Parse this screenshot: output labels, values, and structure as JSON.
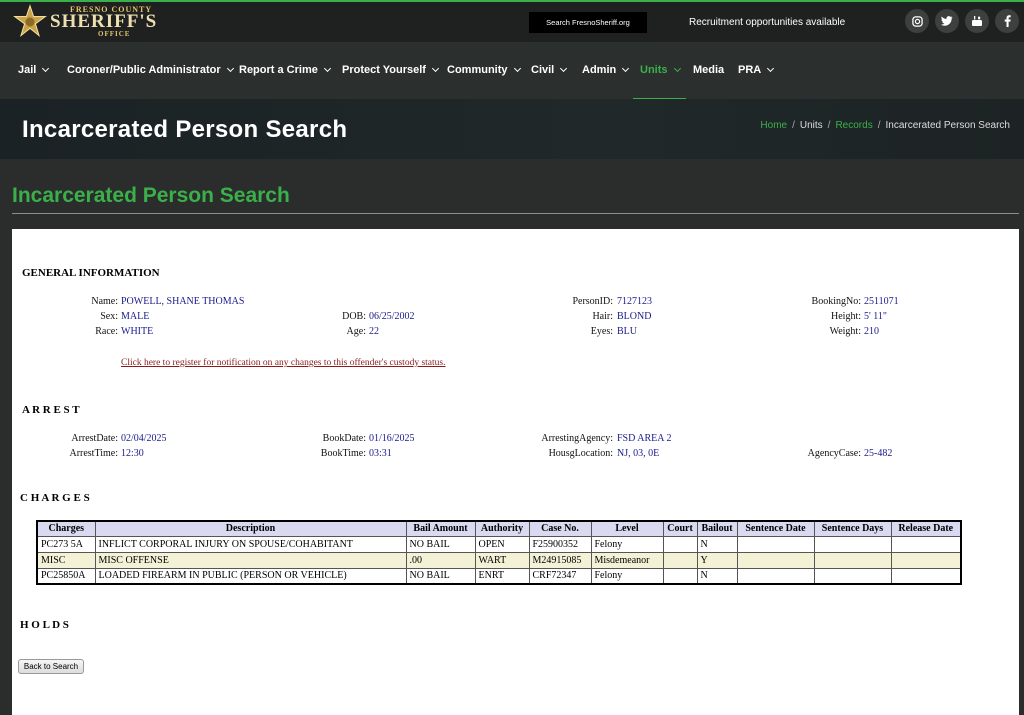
{
  "header": {
    "logo": {
      "county": "FRESNO COUNTY",
      "main": "SHERIFF'S",
      "office": "OFFICE"
    },
    "search_label": "Search FresnoSheriff.org",
    "recruitment_text": "Recruitment opportunities available",
    "social": [
      "instagram-icon",
      "twitter-icon",
      "youtube-icon",
      "facebook-icon"
    ]
  },
  "nav": {
    "items": [
      "Jail",
      "Coroner/Public Administrator",
      "Report a Crime",
      "Protect Yourself",
      "Community",
      "Civil",
      "Admin",
      "Units",
      "Media",
      "PRA"
    ],
    "active": "Units"
  },
  "hero": {
    "title": "Incarcerated Person Search",
    "breadcrumb": [
      "Home",
      "Units",
      "Records",
      "Incarcerated Person Search"
    ]
  },
  "page_title": "Incarcerated Person Search",
  "general": {
    "heading": "GENERAL INFORMATION",
    "name_label": "Name:",
    "name": "POWELL, SHANE THOMAS",
    "sex_label": "Sex:",
    "sex": "MALE",
    "race_label": "Race:",
    "race": "WHITE",
    "dob_label": "DOB:",
    "dob": "06/25/2002",
    "age_label": "Age:",
    "age": "22",
    "personid_label": "PersonID:",
    "personid": "7127123",
    "hair_label": "Hair:",
    "hair": "BLOND",
    "eyes_label": "Eyes:",
    "eyes": "BLU",
    "bookingno_label": "BookingNo:",
    "bookingno": "2511071",
    "height_label": "Height:",
    "height": "5' 11\"",
    "weight_label": "Weight:",
    "weight": "210",
    "notify_link": "Click here to register for notification on any changes to this offender's custody status."
  },
  "arrest": {
    "heading": "A R R E S T",
    "arrestdate_label": "ArrestDate:",
    "arrestdate": "02/04/2025",
    "arresttime_label": "ArrestTime:",
    "arresttime": "12:30",
    "bookdate_label": "BookDate:",
    "bookdate": "01/16/2025",
    "booktime_label": "BookTime:",
    "booktime": "03:31",
    "agency_label": "ArrestingAgency:",
    "agency": "FSD AREA 2",
    "housing_label": "HousgLocation:",
    "housing": "NJ, 03, 0E",
    "agencycase_label": "AgencyCase:",
    "agencycase": "25-482"
  },
  "charges": {
    "heading": "C H A R G E S",
    "columns": [
      "Charges",
      "Description",
      "Bail Amount",
      "Authority",
      "Case No.",
      "Level",
      "Court",
      "Bailout",
      "Sentence Date",
      "Sentence Days",
      "Release Date"
    ],
    "rows": [
      [
        "PC273 5A",
        "INFLICT CORPORAL INJURY ON SPOUSE/COHABITANT",
        "NO BAIL",
        "OPEN",
        "F25900352",
        "Felony",
        "",
        "N",
        "",
        "",
        ""
      ],
      [
        "MISC",
        "MISC OFFENSE",
        ".00",
        "WART",
        "M24915085",
        "Misdemeanor",
        "",
        "Y",
        "",
        "",
        ""
      ],
      [
        "PC25850A",
        "LOADED FIREARM IN PUBLIC (PERSON OR VEHICLE)",
        "NO BAIL",
        "ENRT",
        "CRF72347",
        "Felony",
        "",
        "N",
        "",
        "",
        ""
      ]
    ]
  },
  "holds": {
    "heading": "H O L D S"
  },
  "back_button": "Back to Search"
}
